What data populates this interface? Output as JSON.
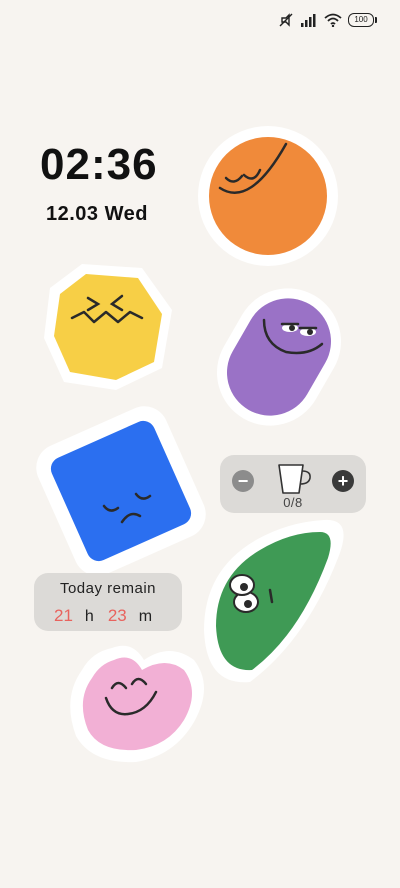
{
  "status_bar": {
    "battery": "100"
  },
  "clock": {
    "time": "02:36",
    "date": "12.03 Wed"
  },
  "stickers": [
    {
      "name": "orange-circle",
      "color": "#f08a3a"
    },
    {
      "name": "yellow-octagon",
      "color": "#f7cf46"
    },
    {
      "name": "purple-pill",
      "color": "#9a72c6"
    },
    {
      "name": "blue-square",
      "color": "#2b6ff0"
    },
    {
      "name": "green-half-circle",
      "color": "#3f9a55"
    },
    {
      "name": "pink-heart",
      "color": "#f2b0d5"
    }
  ],
  "water": {
    "minus": "−",
    "plus": "+",
    "count": "0/8"
  },
  "remain": {
    "title": "Today remain",
    "hours": "21",
    "hours_unit": "h",
    "minutes": "23",
    "minutes_unit": "m"
  }
}
